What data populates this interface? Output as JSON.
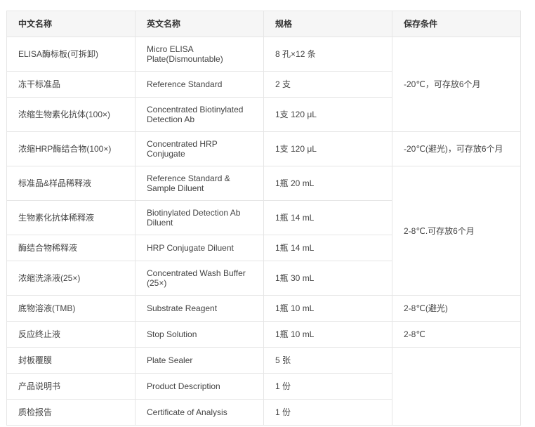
{
  "table": {
    "headers": [
      "中文名称",
      "英文名称",
      "规格",
      "保存条件"
    ],
    "rows": [
      {
        "cn": "ELISA酶标板(可拆卸)",
        "en": "Micro ELISA Plate(Dismountable)",
        "spec": "8 孔×12 条"
      },
      {
        "cn": "冻干标准品",
        "en": "Reference Standard",
        "spec": "2 支"
      },
      {
        "cn": "浓缩生物素化抗体(100×)",
        "en": "Concentrated Biotinylated Detection Ab",
        "spec": "1支 120 μL"
      },
      {
        "cn": "浓缩HRP酶结合物(100×)",
        "en": "Concentrated HRP Conjugate",
        "spec": "1支 120 μL"
      },
      {
        "cn": "标准品&样品稀释液",
        "en": "Reference Standard & Sample Diluent",
        "spec": "1瓶 20 mL"
      },
      {
        "cn": "生物素化抗体稀释液",
        "en": "Biotinylated Detection Ab Diluent",
        "spec": "1瓶 14 mL"
      },
      {
        "cn": "酶结合物稀释液",
        "en": "HRP Conjugate Diluent",
        "spec": "1瓶 14 mL"
      },
      {
        "cn": "浓缩洗涤液(25×)",
        "en": "Concentrated Wash Buffer (25×)",
        "spec": "1瓶 30 mL"
      },
      {
        "cn": "底物溶液(TMB)",
        "en": "Substrate Reagent",
        "spec": "1瓶 10 mL"
      },
      {
        "cn": "反应终止液",
        "en": "Stop Solution",
        "spec": "1瓶 10 mL"
      },
      {
        "cn": "封板覆膜",
        "en": "Plate Sealer",
        "spec": "5 张"
      },
      {
        "cn": "产品说明书",
        "en": "Product Description",
        "spec": "1 份"
      },
      {
        "cn": "质检报告",
        "en": "Certificate of Analysis",
        "spec": "1 份"
      }
    ],
    "storage": [
      "-20℃，可存放6个月",
      "-20℃(避光)，可存放6个月",
      "2-8℃.可存放6个月",
      "2-8℃(避光)",
      "2-8℃",
      ""
    ]
  }
}
